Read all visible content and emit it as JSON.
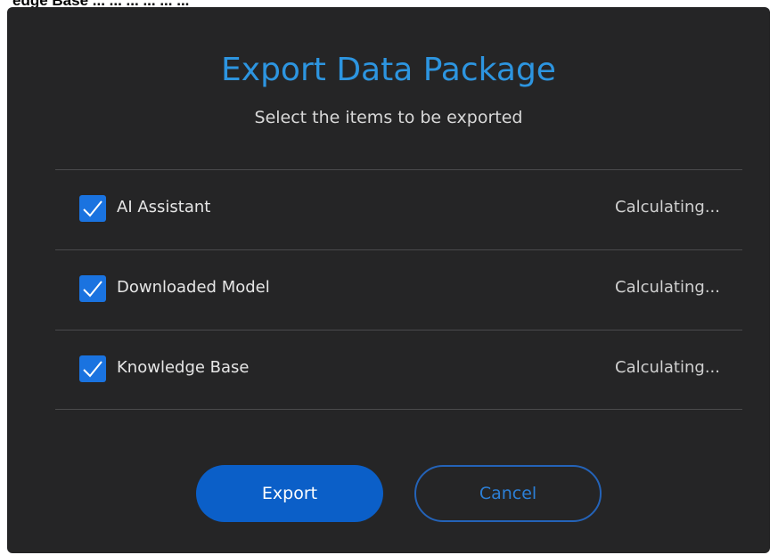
{
  "header_clip": {
    "text": "edge Base ... ... ... ... ... ..."
  },
  "dialog": {
    "title": "Export Data Package",
    "subtitle": "Select the items to be exported",
    "items": [
      {
        "label": "AI Assistant",
        "status": "Calculating...",
        "checked": true
      },
      {
        "label": "Downloaded Model",
        "status": "Calculating...",
        "checked": true
      },
      {
        "label": "Knowledge Base",
        "status": "Calculating...",
        "checked": true
      }
    ],
    "buttons": {
      "export_label": "Export",
      "cancel_label": "Cancel"
    }
  },
  "colors": {
    "dialog_background": "#252526",
    "title": "#2d95e0",
    "checkbox": "#1a73e0",
    "primary_button": "#0b5fc8",
    "secondary_button_border": "#2463b8"
  },
  "icons": {
    "checkbox_mark": "checkmark-icon"
  }
}
